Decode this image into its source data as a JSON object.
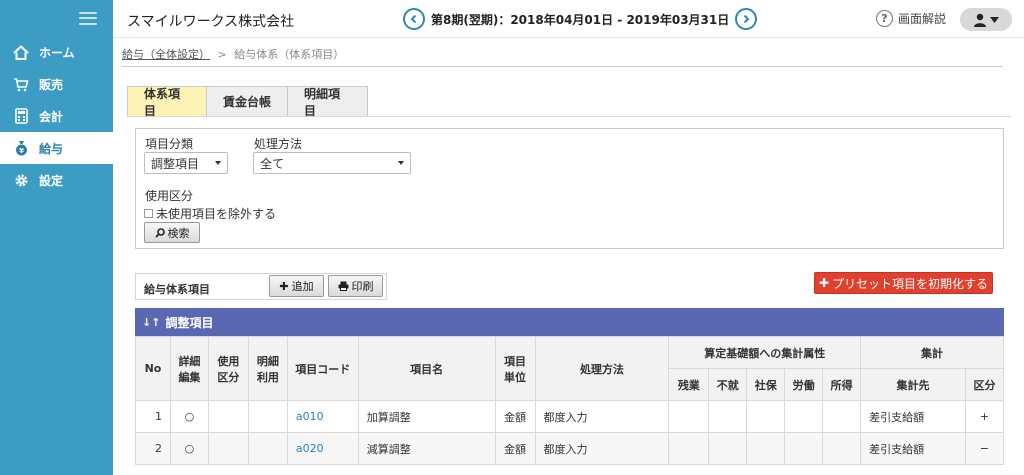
{
  "sidebar": {
    "items": [
      {
        "label": "ホーム",
        "icon": "home-icon",
        "active": false
      },
      {
        "label": "販売",
        "icon": "cart-icon",
        "active": false
      },
      {
        "label": "会計",
        "icon": "calculator-icon",
        "active": false
      },
      {
        "label": "給与",
        "icon": "money-bag-icon",
        "active": true
      },
      {
        "label": "設定",
        "icon": "gear-icon",
        "active": false
      }
    ]
  },
  "header": {
    "company": "スマイルワークス株式会社",
    "period": "第8期(翌期)：2018年04月01日 - 2019年03月31日",
    "help_label": "画面解説"
  },
  "breadcrumb": {
    "link": "給与（全体設定）",
    "separator": ">",
    "current": "給与体系（体系項目）"
  },
  "tabs": [
    {
      "label": "体系項目",
      "active": true
    },
    {
      "label": "賃金台帳",
      "active": false
    },
    {
      "label": "明細項目",
      "active": false
    }
  ],
  "search": {
    "category_label": "項目分類",
    "category_value": "調整項目",
    "method_label": "処理方法",
    "method_value": "全て",
    "usage_label": "使用区分",
    "exclude_label": "未使用項目を除外する",
    "search_button": "検索"
  },
  "list": {
    "title": "給与体系項目",
    "add_button": "追加",
    "print_button": "印刷",
    "reset_button": "プリセット項目を初期化する",
    "section_title": "調整項目"
  },
  "table": {
    "headers": {
      "no": "No",
      "detail_edit": [
        "詳細",
        "編集"
      ],
      "usage": [
        "使用",
        "区分"
      ],
      "itemize": [
        "明細",
        "利用"
      ],
      "code": "項目コード",
      "name": "項目名",
      "unit": [
        "項目",
        "単位"
      ],
      "method": "処理方法",
      "basis_group": "算定基礎額への集計属性",
      "basis": [
        "残業",
        "不就",
        "社保",
        "労働",
        "所得"
      ],
      "total_group": "集計",
      "total_target": "集計先",
      "total_class": "区分"
    },
    "rows": [
      {
        "no": "1",
        "edit": "○",
        "code": "a010",
        "name": "加算調整",
        "unit": "金額",
        "method": "都度入力",
        "target": "差引支給額",
        "class": "+"
      },
      {
        "no": "2",
        "edit": "○",
        "code": "a020",
        "name": "減算調整",
        "unit": "金額",
        "method": "都度入力",
        "target": "差引支給額",
        "class": "−"
      }
    ]
  },
  "colors": {
    "sidebar": "#3d9cc4",
    "section_bar": "#5a68b3",
    "active_tab": "#fdf3b6",
    "danger_button": "#e0402d",
    "link": "#2a7fbf"
  }
}
